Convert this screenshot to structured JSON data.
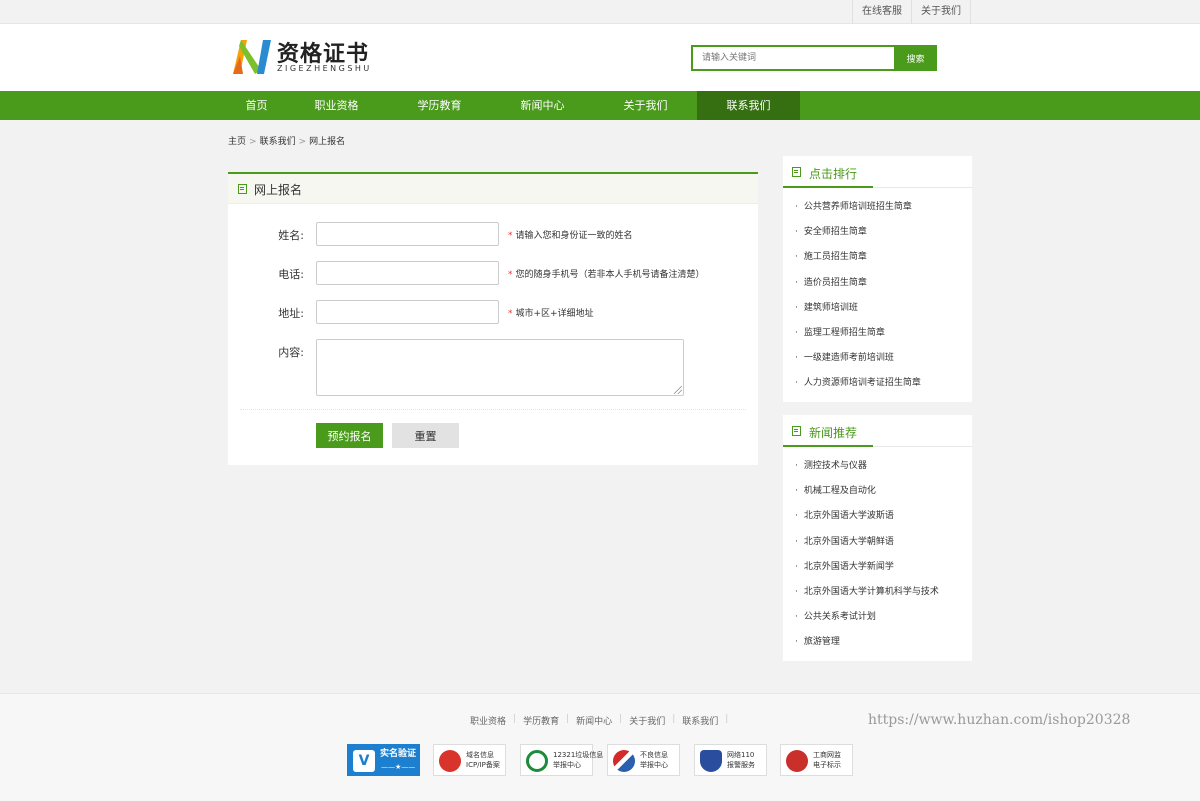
{
  "topbar": {
    "links": [
      "在线客服",
      "关于我们"
    ]
  },
  "header": {
    "logo_main": "资格证书",
    "logo_sub": "ZIGEZHENGSHU",
    "search_placeholder": "请输入关键词",
    "search_button": "搜索"
  },
  "nav": {
    "items": [
      "首页",
      "职业资格",
      "学历教育",
      "新闻中心",
      "关于我们",
      "联系我们"
    ],
    "active_index": 5
  },
  "breadcrumb": {
    "items": [
      "主页",
      "联系我们",
      "网上报名"
    ],
    "separator": ">"
  },
  "form": {
    "title": "网上报名",
    "fields": [
      {
        "label": "姓名:",
        "hint": "请输入您和身份证一致的姓名",
        "required_mark": "*"
      },
      {
        "label": "电话:",
        "hint": "您的随身手机号（若非本人手机号请备注清楚）",
        "required_mark": "*"
      },
      {
        "label": "地址:",
        "hint": "城市+区+详细地址",
        "required_mark": "*"
      }
    ],
    "content_label": "内容:",
    "submit": "预约报名",
    "reset": "重置"
  },
  "sidebar": {
    "ranking": {
      "title": "点击排行",
      "items": [
        "公共营养师培训班招生简章",
        "安全师招生简章",
        "施工员招生简章",
        "造价员招生简章",
        "建筑师培训班",
        "监理工程师招生简章",
        "一级建造师考前培训班",
        "人力资源师培训考证招生简章"
      ]
    },
    "news": {
      "title": "新闻推荐",
      "items": [
        "测控技术与仪器",
        "机械工程及自动化",
        "北京外国语大学波斯语",
        "北京外国语大学朝鲜语",
        "北京外国语大学新闻学",
        "北京外国语大学计算机科学与技术",
        "公共关系考试计划",
        "旅游管理"
      ]
    }
  },
  "footer": {
    "links": [
      "职业资格",
      "学历教育",
      "新闻中心",
      "关于我们",
      "联系我们"
    ],
    "watermark": "https://www.huzhan.com/ishop20328",
    "badges": [
      {
        "line1": "实名验证",
        "line2": "——★——",
        "icon": "verified-v-icon",
        "color": "#1d7fcf"
      },
      {
        "line1": "域名信息",
        "line2": "ICP/IP备案",
        "icon": "national-emblem-icon",
        "color": "#d9342b"
      },
      {
        "line1": "12321垃圾信息",
        "line2": "举报中心",
        "icon": "report-z-icon",
        "color": "#1e8c3a"
      },
      {
        "line1": "不良信息",
        "line2": "举报中心",
        "icon": "swoosh-icon",
        "color": "#d62a2a"
      },
      {
        "line1": "网络110",
        "line2": "报警服务",
        "icon": "police-shield-icon",
        "color": "#2b4d9e"
      },
      {
        "line1": "工商网监",
        "line2": "电子标示",
        "icon": "commerce-emblem-icon",
        "color": "#c9302c"
      }
    ]
  }
}
